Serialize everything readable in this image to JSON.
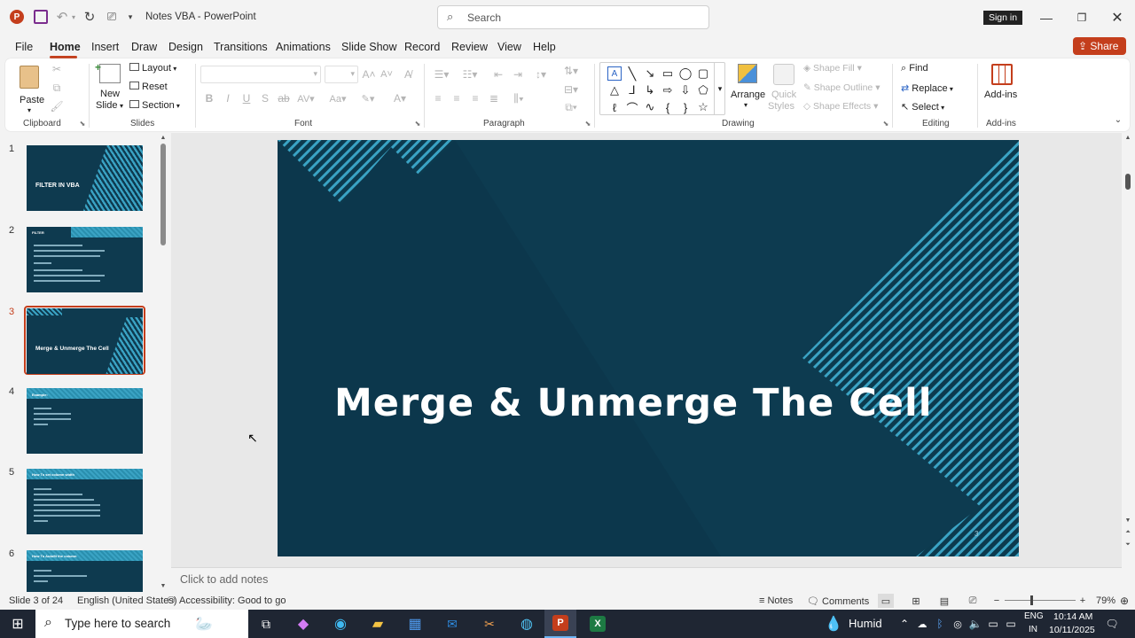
{
  "window": {
    "title": "Notes VBA  -  PowerPoint",
    "sign_in": "Sign in"
  },
  "search": {
    "placeholder": "Search"
  },
  "menu": {
    "items": [
      "File",
      "Home",
      "Insert",
      "Draw",
      "Design",
      "Transitions",
      "Animations",
      "Slide Show",
      "Record",
      "Review",
      "View",
      "Help"
    ],
    "active": "Home",
    "share": "Share"
  },
  "ribbon": {
    "clipboard": {
      "paste": "Paste",
      "group": "Clipboard"
    },
    "slides": {
      "new_slide": "New",
      "new_slide2": "Slide",
      "layout": "Layout",
      "reset": "Reset",
      "section": "Section",
      "group": "Slides"
    },
    "font": {
      "group": "Font"
    },
    "paragraph": {
      "group": "Paragraph"
    },
    "drawing": {
      "arrange": "Arrange",
      "quick_styles": "Quick",
      "quick_styles2": "Styles",
      "shape_fill": "Shape Fill",
      "shape_outline": "Shape Outline",
      "shape_effects": "Shape Effects",
      "group": "Drawing"
    },
    "editing": {
      "find": "Find",
      "replace": "Replace",
      "select": "Select",
      "group": "Editing"
    },
    "addins": {
      "label": "Add-ins",
      "group": "Add-ins"
    }
  },
  "thumbnails": [
    {
      "num": "1",
      "title": "FILTER IN VBA"
    },
    {
      "num": "2",
      "title": "FILTER"
    },
    {
      "num": "3",
      "title": "Merge & Unmerge The Cell"
    },
    {
      "num": "4",
      "title": "Example:"
    },
    {
      "num": "5",
      "title": "How To set column width"
    },
    {
      "num": "6",
      "title": "How To Autofit the column"
    }
  ],
  "selected_slide": 3,
  "slide": {
    "title": "Merge & Unmerge The Cell",
    "page_number": "3"
  },
  "notes": {
    "placeholder": "Click to add notes"
  },
  "status": {
    "slide_info": "Slide 3 of 24",
    "language": "English (United States)",
    "accessibility": "Accessibility: Good to go",
    "notes": "Notes",
    "comments": "Comments",
    "zoom": "79%"
  },
  "taskbar": {
    "search_placeholder": "Type here to search",
    "weather": "Humid",
    "lang1": "ENG",
    "lang2": "IN",
    "time": "10:14 AM",
    "date": "10/11/2025"
  },
  "colors": {
    "accent": "#c43e1c",
    "slide_bg": "#0c3a4e",
    "stripe": "#3aa3c4"
  }
}
